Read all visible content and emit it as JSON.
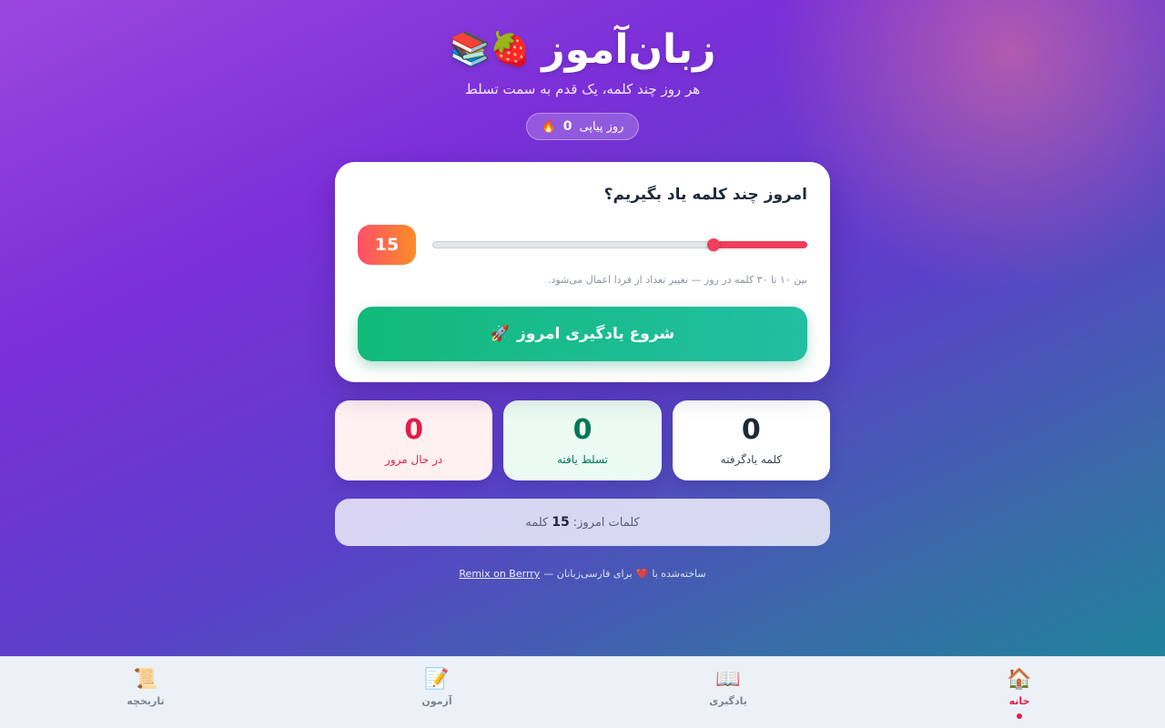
{
  "header": {
    "title": "زبان‌آموز",
    "title_emoji": "🍓📚",
    "subtitle": "هر روز چند کلمه، یک قدم به سمت تسلط",
    "streak_icon": "🔥",
    "streak_count": "0",
    "streak_label": "روز پیاپی"
  },
  "daily": {
    "question": "امروز چند کلمه یاد بگیریم؟",
    "count": 15,
    "count_label": "15",
    "min": 10,
    "max": 30,
    "hint": "بین ۱۰ تا ۳۰ کلمه در روز — تغییر تعداد از فردا اعمال می‌شود.",
    "start_label": "شروع یادگیری امروز",
    "start_icon": "🚀"
  },
  "stats": [
    {
      "value": "0",
      "label": "کلمه یادگرفته"
    },
    {
      "value": "0",
      "label": "تسلط یافته"
    },
    {
      "value": "0",
      "label": "در حال مرور"
    }
  ],
  "today_words": {
    "prefix": "کلمات امروز:",
    "count": "15",
    "suffix": "کلمه"
  },
  "footer": {
    "text_before": "ساخته‌شده با",
    "heart": "❤️",
    "text_after": "برای فارسی‌زبانان —",
    "link": "Remix on Berrry"
  },
  "nav": [
    {
      "icon": "🏠",
      "label": "خانه",
      "active": true
    },
    {
      "icon": "📖",
      "label": "یادگیری",
      "active": false
    },
    {
      "icon": "📝",
      "label": "آزمون",
      "active": false
    },
    {
      "icon": "📜",
      "label": "تاریخچه",
      "active": false
    }
  ],
  "colors": {
    "accent": "#f03e5e",
    "start_button": "#12b97a",
    "mastered": "#047857",
    "review": "#e11d48"
  }
}
